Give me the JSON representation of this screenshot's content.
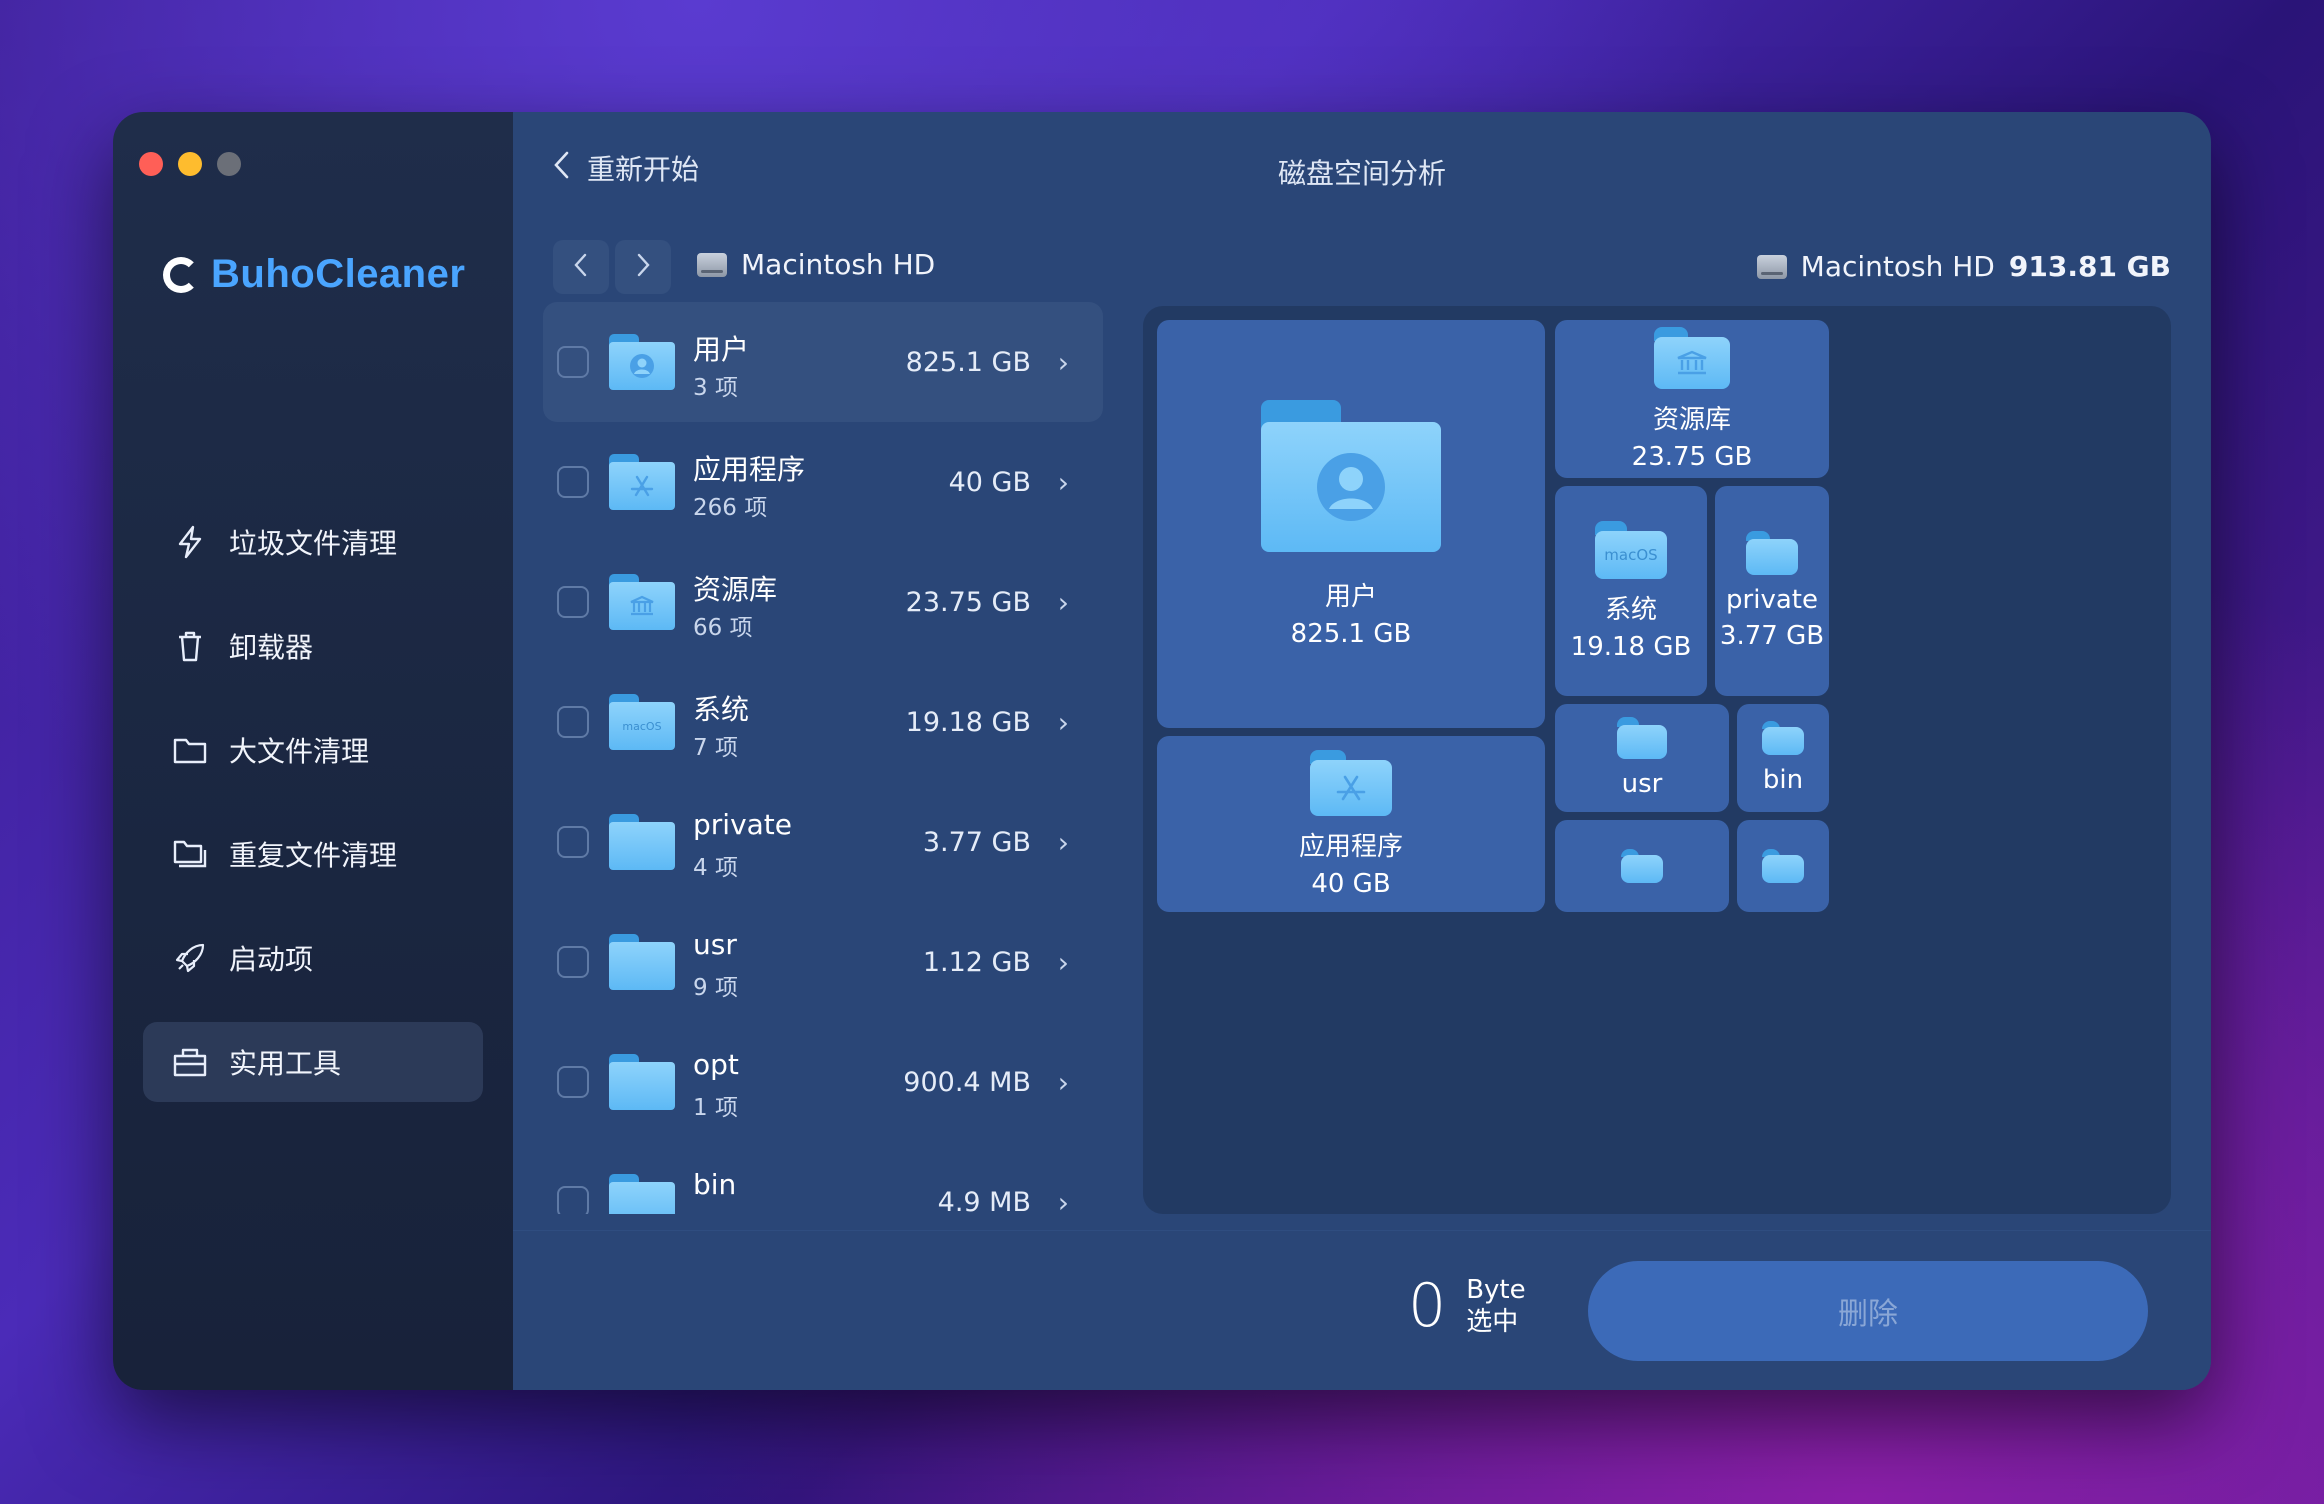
{
  "app": {
    "brand": "BuhoCleaner"
  },
  "sidebar": {
    "items": [
      {
        "label": "垃圾文件清理",
        "icon": "bolt-icon"
      },
      {
        "label": "卸载器",
        "icon": "trash-icon"
      },
      {
        "label": "大文件清理",
        "icon": "folder-icon"
      },
      {
        "label": "重复文件清理",
        "icon": "duplicate-folder-icon"
      },
      {
        "label": "启动项",
        "icon": "rocket-icon"
      },
      {
        "label": "实用工具",
        "icon": "toolbox-icon"
      }
    ]
  },
  "header": {
    "back_label": "重新开始",
    "title": "磁盘空间分析"
  },
  "crumb": {
    "disk_name": "Macintosh HD"
  },
  "summary": {
    "disk_name": "Macintosh HD",
    "total": "913.81 GB"
  },
  "list": [
    {
      "name": "用户",
      "count": "3 项",
      "size": "825.1 GB",
      "icon": "user-icon"
    },
    {
      "name": "应用程序",
      "count": "266 项",
      "size": "40 GB",
      "icon": "app-store-icon"
    },
    {
      "name": "资源库",
      "count": "66 项",
      "size": "23.75 GB",
      "icon": "library-icon"
    },
    {
      "name": "系统",
      "count": "7 项",
      "size": "19.18 GB",
      "icon": "macos-icon"
    },
    {
      "name": "private",
      "count": "4 项",
      "size": "3.77 GB",
      "icon": "folder-icon"
    },
    {
      "name": "usr",
      "count": "9 项",
      "size": "1.12 GB",
      "icon": "folder-icon"
    },
    {
      "name": "opt",
      "count": "1 项",
      "size": "900.4 MB",
      "icon": "folder-icon"
    },
    {
      "name": "bin",
      "count": "",
      "size": "4.9 MB",
      "icon": "folder-icon"
    }
  ],
  "treemap": {
    "users": {
      "label": "用户",
      "size": "825.1 GB"
    },
    "library": {
      "label": "资源库",
      "size": "23.75 GB"
    },
    "system": {
      "label": "系统",
      "size": "19.18 GB",
      "badge": "macOS"
    },
    "private": {
      "label": "private",
      "size": "3.77 GB"
    },
    "apps": {
      "label": "应用程序",
      "size": "40 GB"
    },
    "usr": {
      "label": "usr"
    },
    "bin": {
      "label": "bin"
    }
  },
  "footer": {
    "selected_value": "0",
    "selected_unit": "Byte",
    "selected_label": "选中",
    "delete_label": "删除"
  },
  "colors": {
    "accent": "#4aa5ff",
    "panel": "#2a4677",
    "sidebar": "#1f2d4a",
    "tile": "#3a62a8"
  }
}
